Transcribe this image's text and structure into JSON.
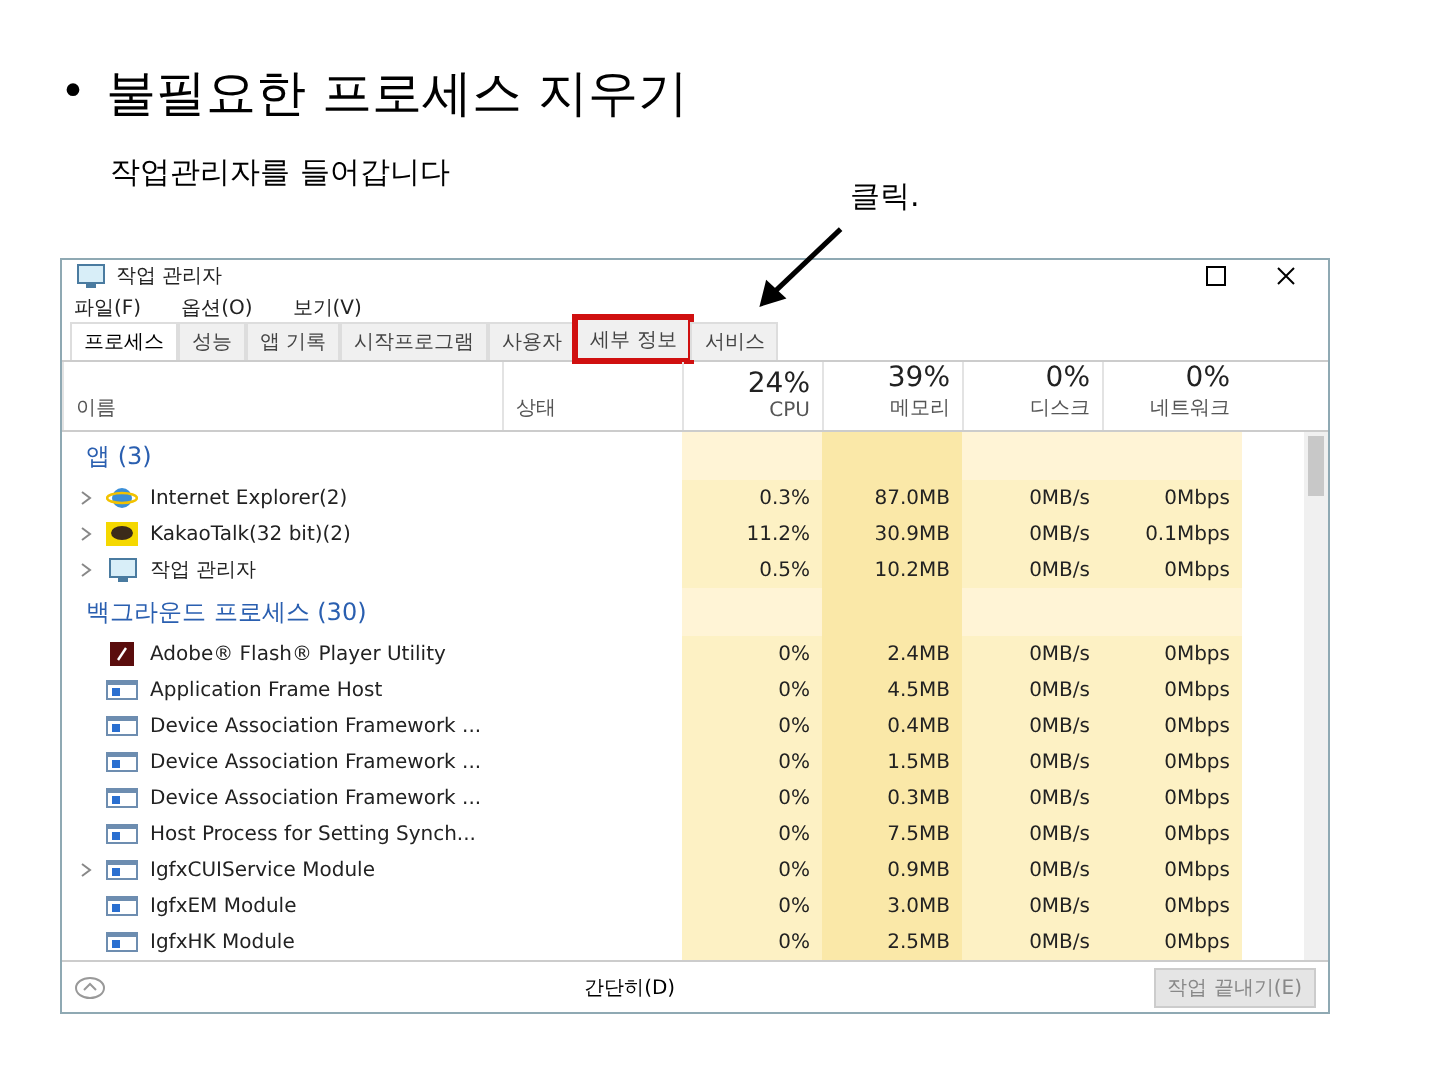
{
  "slide": {
    "bullet": "•",
    "heading": "불필요한 프로세스 지우기",
    "subtitle": "작업관리자를 들어갑니다",
    "callout": "클릭."
  },
  "window": {
    "title": "작업 관리자",
    "menu": [
      "파일(F)",
      "옵션(O)",
      "보기(V)"
    ],
    "tabs": [
      {
        "label": "프로세스",
        "selected": true,
        "highlighted": false
      },
      {
        "label": "성능",
        "selected": false,
        "highlighted": false
      },
      {
        "label": "앱 기록",
        "selected": false,
        "highlighted": false
      },
      {
        "label": "시작프로그램",
        "selected": false,
        "highlighted": false
      },
      {
        "label": "사용자",
        "selected": false,
        "highlighted": false
      },
      {
        "label": "세부 정보",
        "selected": false,
        "highlighted": true
      },
      {
        "label": "서비스",
        "selected": false,
        "highlighted": false
      }
    ],
    "columns": [
      {
        "label": "이름"
      },
      {
        "label": "상태"
      },
      {
        "usage": "24%",
        "label": "CPU"
      },
      {
        "usage": "39%",
        "label": "메모리"
      },
      {
        "usage": "0%",
        "label": "디스크"
      },
      {
        "usage": "0%",
        "label": "네트워크"
      }
    ],
    "groups": [
      {
        "title": "앱 (3)",
        "rows": [
          {
            "kind": "ie",
            "expandable": true,
            "name": "Internet Explorer(2)",
            "cpu": "0.3%",
            "memory": "87.0MB",
            "disk": "0MB/s",
            "network": "0Mbps"
          },
          {
            "kind": "chat",
            "expandable": true,
            "name": "KakaoTalk(32 bit)(2)",
            "cpu": "11.2%",
            "memory": "30.9MB",
            "disk": "0MB/s",
            "network": "0.1Mbps"
          },
          {
            "kind": "monitor",
            "expandable": true,
            "name": "작업 관리자",
            "cpu": "0.5%",
            "memory": "10.2MB",
            "disk": "0MB/s",
            "network": "0Mbps"
          }
        ]
      },
      {
        "title": "백그라운드 프로세스 (30)",
        "rows": [
          {
            "kind": "flash",
            "expandable": false,
            "name": "Adobe® Flash® Player Utility",
            "cpu": "0%",
            "memory": "2.4MB",
            "disk": "0MB/s",
            "network": "0Mbps"
          },
          {
            "kind": "window",
            "expandable": false,
            "name": "Application Frame Host",
            "cpu": "0%",
            "memory": "4.5MB",
            "disk": "0MB/s",
            "network": "0Mbps"
          },
          {
            "kind": "window",
            "expandable": false,
            "name": "Device Association Framework ...",
            "cpu": "0%",
            "memory": "0.4MB",
            "disk": "0MB/s",
            "network": "0Mbps"
          },
          {
            "kind": "window",
            "expandable": false,
            "name": "Device Association Framework ...",
            "cpu": "0%",
            "memory": "1.5MB",
            "disk": "0MB/s",
            "network": "0Mbps"
          },
          {
            "kind": "window",
            "expandable": false,
            "name": "Device Association Framework ...",
            "cpu": "0%",
            "memory": "0.3MB",
            "disk": "0MB/s",
            "network": "0Mbps"
          },
          {
            "kind": "window",
            "expandable": false,
            "name": "Host Process for Setting Synch...",
            "cpu": "0%",
            "memory": "7.5MB",
            "disk": "0MB/s",
            "network": "0Mbps"
          },
          {
            "kind": "window",
            "expandable": true,
            "name": "IgfxCUIService Module",
            "cpu": "0%",
            "memory": "0.9MB",
            "disk": "0MB/s",
            "network": "0Mbps"
          },
          {
            "kind": "window",
            "expandable": false,
            "name": "IgfxEM Module",
            "cpu": "0%",
            "memory": "3.0MB",
            "disk": "0MB/s",
            "network": "0Mbps"
          },
          {
            "kind": "window",
            "expandable": false,
            "name": "IgfxHK Module",
            "cpu": "0%",
            "memory": "2.5MB",
            "disk": "0MB/s",
            "network": "0Mbps"
          }
        ]
      }
    ],
    "footer": {
      "details": "간단히(D)",
      "end_task": "작업 끝내기(E)"
    }
  }
}
